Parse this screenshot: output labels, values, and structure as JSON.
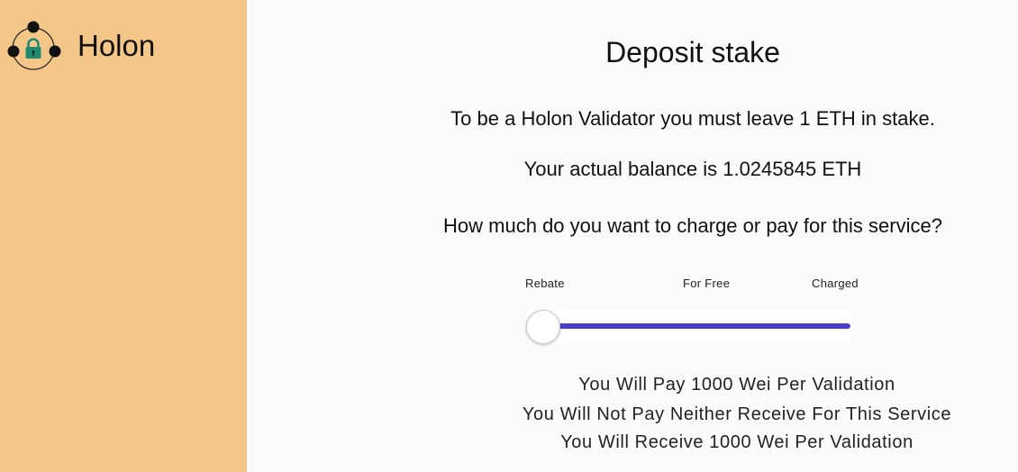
{
  "brand": {
    "name": "Holon",
    "logo_icon": "holon-lock-logo-icon"
  },
  "colors": {
    "sidebar": "#f4c688",
    "slider_track": "#4a3ecf",
    "lock": "#1f8a70"
  },
  "page": {
    "title": "Deposit stake",
    "stake_notice": "To be a Holon Validator you must leave 1 ETH in stake.",
    "balance_text": "Your actual balance is 1.0245845 ETH",
    "question": "How much do you want to charge or pay for this service?"
  },
  "slider": {
    "labels": {
      "rebate": "Rebate",
      "free": "For Free",
      "charged": "Charged"
    },
    "value_fraction": 0.0
  },
  "messages": [
    "You Will Pay 1000 Wei Per Validation",
    "You Will Not Pay Neither Receive For This Service",
    "You Will Receive 1000 Wei Per Validation"
  ]
}
